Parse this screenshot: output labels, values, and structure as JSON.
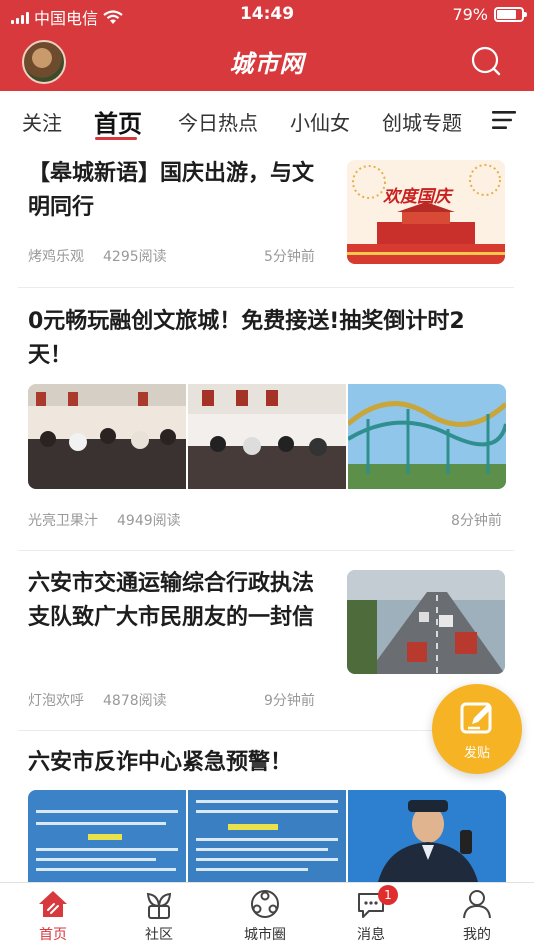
{
  "status": {
    "carrier": "中国电信",
    "time": "14:49",
    "battery": "79%",
    "battery_level": 0.79
  },
  "header": {
    "logo": "城市网"
  },
  "tabs": [
    {
      "label": "关注"
    },
    {
      "label": "首页"
    },
    {
      "label": "今日热点"
    },
    {
      "label": "小仙女"
    },
    {
      "label": "创城专题"
    }
  ],
  "feed": [
    {
      "title": "【皋城新语】国庆出游，与文明同行",
      "source": "烤鸡乐观",
      "reads": "4295阅读",
      "time": "5分钟前",
      "thumb_text": "欢度国庆"
    },
    {
      "title": "0元畅玩融创文旅城！免费接送!抽奖倒计时2天！",
      "source": "光亮卫果汁",
      "reads": "4949阅读",
      "time": "8分钟前"
    },
    {
      "title": "六安市交通运输综合行政执法支队致广大市民朋友的一封信",
      "source": "灯泡欢呼",
      "reads": "4878阅读",
      "time": "9分钟前"
    },
    {
      "title": "六安市反诈中心紧急预警！"
    }
  ],
  "fab": {
    "label": "发贴"
  },
  "bottom_nav": [
    {
      "label": "首页"
    },
    {
      "label": "社区"
    },
    {
      "label": "城市圈"
    },
    {
      "label": "消息",
      "badge": "1"
    },
    {
      "label": "我的"
    }
  ],
  "colors": {
    "brand_red": "#d7393d",
    "fab_yellow": "#f6b323",
    "meta_gray": "#999999"
  }
}
